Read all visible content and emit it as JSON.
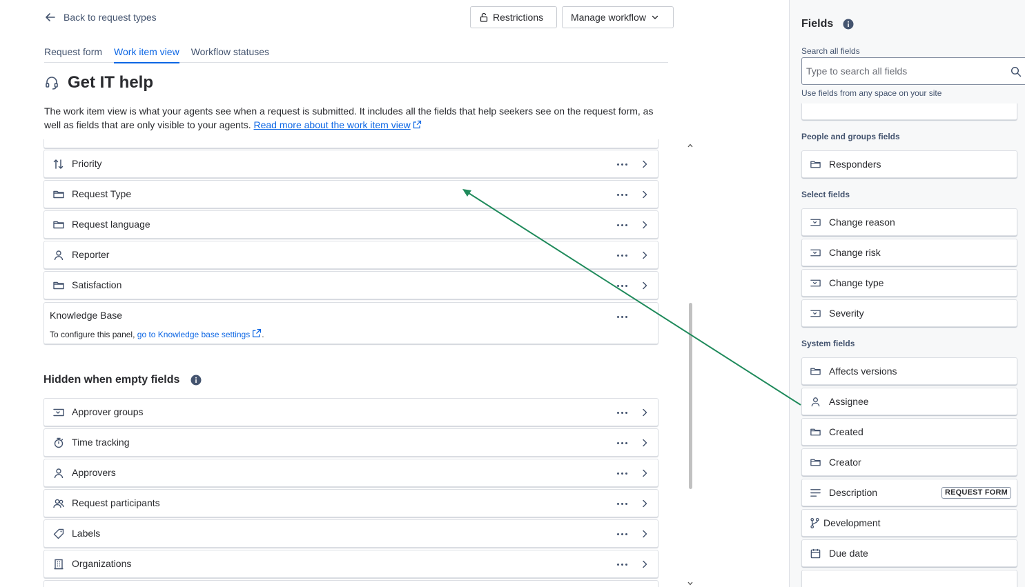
{
  "header": {
    "back_label": "Back to request types",
    "restrictions_label": "Restrictions",
    "manage_workflow_label": "Manage workflow"
  },
  "tabs": [
    {
      "label": "Request form",
      "active": false
    },
    {
      "label": "Work item view",
      "active": true
    },
    {
      "label": "Workflow statuses",
      "active": false
    }
  ],
  "page": {
    "title": "Get IT help",
    "description": "The work item view is what your agents see when a request is submitted. It includes all the fields that help seekers see on the request form, as well as fields that are only visible to your agents.",
    "read_more_link": "Read more about the work item view"
  },
  "visible_fields": [
    {
      "label": "Priority",
      "icon": "priority-arrows-icon"
    },
    {
      "label": "Request Type",
      "icon": "folder-icon"
    },
    {
      "label": "Request language",
      "icon": "folder-icon"
    },
    {
      "label": "Reporter",
      "icon": "person-icon"
    },
    {
      "label": "Satisfaction",
      "icon": "folder-icon"
    }
  ],
  "knowledge_base": {
    "title": "Knowledge Base",
    "hint_prefix": "To configure this panel,",
    "link_text": "go to Knowledge base settings",
    "hint_suffix": "."
  },
  "hidden_section": {
    "heading": "Hidden when empty fields",
    "fields": [
      {
        "label": "Approver groups",
        "icon": "select-list-icon"
      },
      {
        "label": "Time tracking",
        "icon": "stopwatch-icon"
      },
      {
        "label": "Approvers",
        "icon": "person-icon"
      },
      {
        "label": "Request participants",
        "icon": "people-icon"
      },
      {
        "label": "Labels",
        "icon": "tag-icon"
      },
      {
        "label": "Organizations",
        "icon": "building-icon"
      }
    ]
  },
  "sidebar": {
    "title": "Fields",
    "search_label": "Search all fields",
    "search_placeholder": "Type to search all fields",
    "search_value": "",
    "search_hint": "Use fields from any space on your site",
    "groups": [
      {
        "label": "People and groups fields",
        "fields": [
          {
            "label": "Responders",
            "icon": "folder-icon"
          }
        ]
      },
      {
        "label": "Select fields",
        "fields": [
          {
            "label": "Change reason",
            "icon": "select-list-icon"
          },
          {
            "label": "Change risk",
            "icon": "select-list-icon"
          },
          {
            "label": "Change type",
            "icon": "select-list-icon"
          },
          {
            "label": "Severity",
            "icon": "select-list-icon"
          }
        ]
      },
      {
        "label": "System fields",
        "fields": [
          {
            "label": "Affects versions",
            "icon": "folder-icon"
          },
          {
            "label": "Assignee",
            "icon": "person-icon"
          },
          {
            "label": "Created",
            "icon": "folder-icon"
          },
          {
            "label": "Creator",
            "icon": "folder-icon"
          },
          {
            "label": "Description",
            "icon": "text-lines-icon",
            "badge": "REQUEST FORM"
          },
          {
            "label": "Development",
            "icon": "branch-icon"
          },
          {
            "label": "Due date",
            "icon": "calendar-icon"
          }
        ]
      }
    ]
  },
  "colors": {
    "accent": "#0c66e4",
    "drag_arrow": "#1f8a5b",
    "text": "#292a2e",
    "subtle_text": "#44546f",
    "border": "#dcdfe4",
    "sidebar_bg": "#f7f8f9"
  }
}
